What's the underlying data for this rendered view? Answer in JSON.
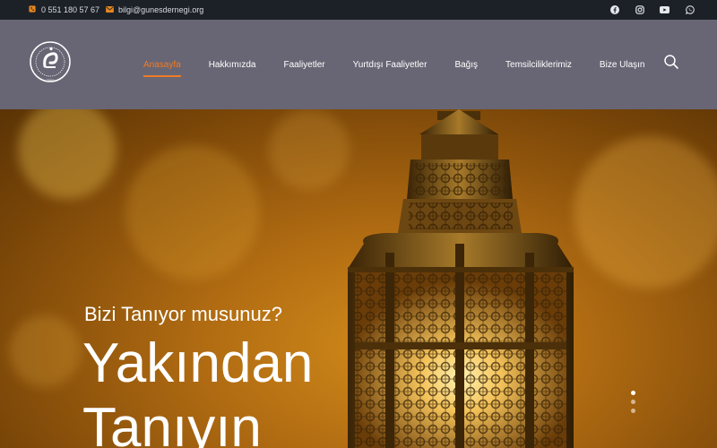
{
  "topbar": {
    "phone_icon": "phone-icon",
    "phone": "0 551 180 57 67",
    "email_icon": "envelope-icon",
    "email": "bilgi@gunesdernegi.org",
    "social": [
      "facebook-icon",
      "instagram-icon",
      "youtube-icon",
      "whatsapp-icon"
    ]
  },
  "header": {
    "logo_text": "GÜNEŞ KÜLTÜR SANAT EĞİTİM VE DAYANIŞMA DERNEĞİ",
    "logo_year": "2009",
    "nav": [
      {
        "label": "Anasayfa",
        "active": true
      },
      {
        "label": "Hakkımızda",
        "active": false
      },
      {
        "label": "Faaliyetler",
        "active": false
      },
      {
        "label": "Yurtdışı Faaliyetler",
        "active": false
      },
      {
        "label": "Bağış",
        "active": false
      },
      {
        "label": "Temsilciliklerimiz",
        "active": false
      },
      {
        "label": "Bize Ulaşın",
        "active": false
      }
    ],
    "search_icon": "search-icon"
  },
  "hero": {
    "subtitle": "Bizi Tanıyor musunuz?",
    "title": "Yakından Tanıyın",
    "slides_total": 3,
    "slide_active": 1
  },
  "colors": {
    "topbar_bg": "#1c2127",
    "header_bg": "#686674",
    "accent": "#ef7b28"
  }
}
